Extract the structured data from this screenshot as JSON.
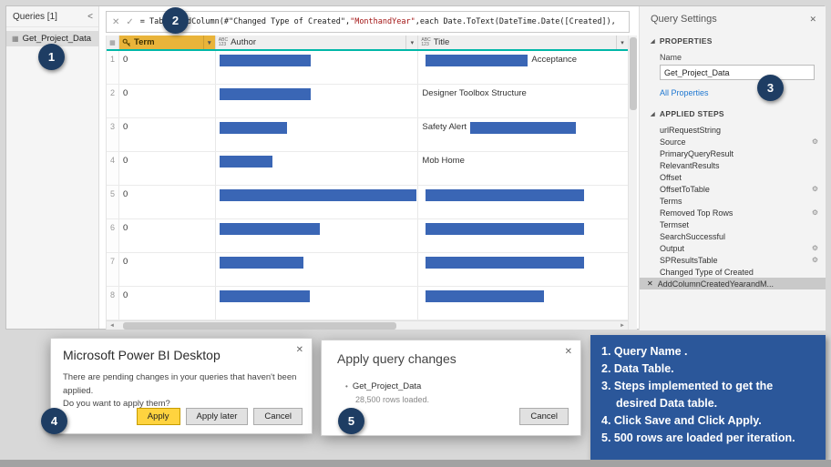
{
  "colors": {
    "redaction_bar": "#3a66b5",
    "term_header_bg": "#e9b43a",
    "header_underline": "#00b7a8",
    "note_box_bg": "#2b579a",
    "callout_circle_bg": "#1e3d63",
    "apply_button_bg": "#ffd33f",
    "string_literal": "#a31515",
    "link": "#1f78d1"
  },
  "icons": {
    "collapse": "<",
    "close": "✕",
    "check": "✓",
    "cancel": "✕",
    "dropdown": "▾",
    "table_glyph": "▦",
    "abc": "ABC",
    "num": "123",
    "gear": "⚙",
    "delete_step": "✕",
    "section_arrow": "◢",
    "scroll_left": "◄",
    "scroll_right": "►",
    "bullet": "•"
  },
  "queries_panel": {
    "title": "Queries [1]",
    "item": "Get_Project_Data"
  },
  "formula": {
    "segments": [
      "= Table.AddColumn(#\"Changed Type of Created\",",
      "\"MonthandYear\"",
      ",each Date.ToText(DateTime.Date([Created]),"
    ]
  },
  "table": {
    "headers": {
      "term": "Term",
      "author": "Author",
      "title": "Title"
    },
    "rows": [
      {
        "num": "1",
        "term": "0",
        "author_bar": 100,
        "title_before": "",
        "title_bar": 112,
        "title_after": "Acceptance"
      },
      {
        "num": "2",
        "term": "0",
        "author_bar": 100,
        "title_before": "Designer Toolbox Structure",
        "title_bar": 0,
        "title_after": ""
      },
      {
        "num": "3",
        "term": "0",
        "author_bar": 74,
        "title_before": "Safety Alert",
        "title_bar": 116,
        "title_after": ""
      },
      {
        "num": "4",
        "term": "0",
        "author_bar": 58,
        "title_before": "Mob Home",
        "title_bar": 0,
        "title_after": ""
      },
      {
        "num": "5",
        "term": "0",
        "author_bar": 216,
        "title_before": "",
        "title_bar": 174,
        "title_after": ""
      },
      {
        "num": "6",
        "term": "0",
        "author_bar": 110,
        "title_before": "",
        "title_bar": 174,
        "title_after": ""
      },
      {
        "num": "7",
        "term": "0",
        "author_bar": 92,
        "title_before": "",
        "title_bar": 174,
        "title_after": ""
      },
      {
        "num": "8",
        "term": "0",
        "author_bar": 99,
        "title_before": "",
        "title_bar": 130,
        "title_after": ""
      }
    ]
  },
  "query_settings": {
    "title": "Query Settings",
    "properties_label": "PROPERTIES",
    "name_label": "Name",
    "name_value": "Get_Project_Data",
    "all_properties": "All Properties",
    "applied_steps_label": "APPLIED STEPS",
    "steps": [
      {
        "label": "urlRequestString",
        "gear": false,
        "selected": false
      },
      {
        "label": "Source",
        "gear": true,
        "selected": false
      },
      {
        "label": "PrimaryQueryResult",
        "gear": false,
        "selected": false
      },
      {
        "label": "RelevantResults",
        "gear": false,
        "selected": false
      },
      {
        "label": "Offset",
        "gear": false,
        "selected": false
      },
      {
        "label": "OffsetToTable",
        "gear": true,
        "selected": false
      },
      {
        "label": "Terms",
        "gear": false,
        "selected": false
      },
      {
        "label": "Removed Top Rows",
        "gear": true,
        "selected": false
      },
      {
        "label": "Termset",
        "gear": false,
        "selected": false
      },
      {
        "label": "SearchSuccessful",
        "gear": false,
        "selected": false
      },
      {
        "label": "Output",
        "gear": true,
        "selected": false
      },
      {
        "label": "SPResultsTable",
        "gear": true,
        "selected": false
      },
      {
        "label": "Changed Type of Created",
        "gear": false,
        "selected": false
      },
      {
        "label": "AddColumnCreatedYearandM...",
        "gear": false,
        "selected": true
      }
    ]
  },
  "dialogs": {
    "pending": {
      "title": "Microsoft Power BI Desktop",
      "line1": "There are pending changes in your queries that haven't been applied.",
      "line2": "Do you want to apply them?",
      "apply": "Apply",
      "apply_later": "Apply later",
      "cancel": "Cancel"
    },
    "apply_changes": {
      "title": "Apply query changes",
      "query": "Get_Project_Data",
      "status": "28,500 rows loaded.",
      "cancel": "Cancel"
    }
  },
  "callouts": {
    "c1": "1",
    "c2": "2",
    "c3": "3",
    "c4": "4",
    "c5": "5"
  },
  "notes": [
    "1. Query Name .",
    "2. Data Table.",
    "3. Steps implemented to get the desired Data table.",
    "4. Click Save and Click Apply.",
    "5. 500 rows are loaded per iteration."
  ]
}
